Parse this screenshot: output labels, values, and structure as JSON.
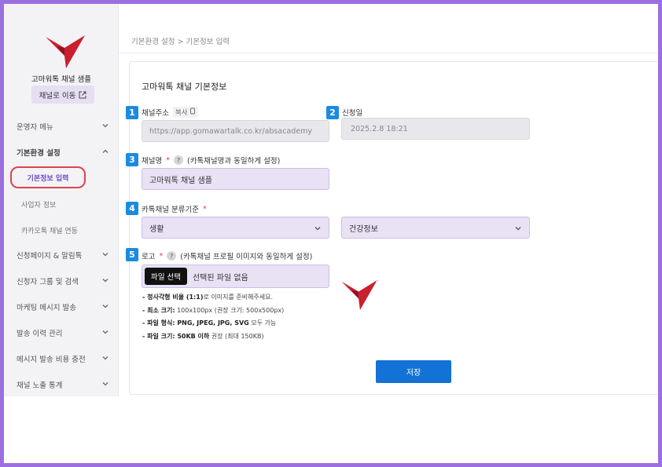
{
  "sidebar": {
    "brand_name": "고마워톡 채널 샘플",
    "goto_label": "채널로 이동",
    "menu": [
      {
        "label": "운영자 메뉴"
      },
      {
        "label": "기본환경 설정"
      },
      {
        "label": "신청페이지 & 알림톡"
      },
      {
        "label": "신청자 그룹 및 검색"
      },
      {
        "label": "마케팅 메시지 발송"
      },
      {
        "label": "발송 이력 관리"
      },
      {
        "label": "메시지 발송 비용 충전"
      },
      {
        "label": "채널 노출 통계"
      }
    ],
    "submenu": [
      {
        "label": "기본정보 입력"
      },
      {
        "label": "사업자 정보"
      },
      {
        "label": "카카오톡 채널 연동"
      }
    ]
  },
  "breadcrumb": "기본환경 설정 > 기본정보 입력",
  "form": {
    "title": "고마워톡 채널 기본정보",
    "steps": [
      "1",
      "2",
      "3",
      "4",
      "5"
    ],
    "channel_url": {
      "label": "채널주소",
      "copy_label": "복사",
      "value": "https://app.gomawartalk.co.kr/absacademy"
    },
    "apply_date": {
      "label": "신청일",
      "value": "2025.2.8 18:21"
    },
    "channel_name": {
      "label": "채널명",
      "required": "*",
      "hint": "(카톡채널명과 동일하게 설정)",
      "value": "고마워톡 채널 샘플"
    },
    "category": {
      "label": "카톡채널 분류기준",
      "required": "*",
      "primary": "생활",
      "secondary": "건강정보"
    },
    "logo": {
      "label": "로고",
      "required": "*",
      "hint": "(카톡채널 프로필 이미지와 동일하게 설정)",
      "file_button": "파일 선택",
      "file_status": "선택된 파일 없음",
      "rules": [
        {
          "strong": "- 정사각형 비율 (1:1)",
          "text": "로 이미지를 준비해주세요."
        },
        {
          "strong": "- 최소 크기:",
          "text": " 100x100px (권장 크기: 500x500px)"
        },
        {
          "strong": "- 파일 형식: PNG, JPEG, JPG, SVG",
          "text": " 모두 가능"
        },
        {
          "strong": "- 파일 크기: 50KB 이하",
          "text": " 권장 (최대 150KB)"
        }
      ]
    },
    "save_label": "저장"
  },
  "colors": {
    "accent": "#1272d6",
    "brand_red": "#c8202e",
    "badge": "#1b8be0",
    "frame": "#9b6fe0",
    "highlight": "#e0424f"
  },
  "icons": [
    "brand-logo-icon",
    "external-link-icon",
    "chevron-down-icon",
    "chevron-up-icon",
    "copy-icon",
    "help-icon"
  ]
}
